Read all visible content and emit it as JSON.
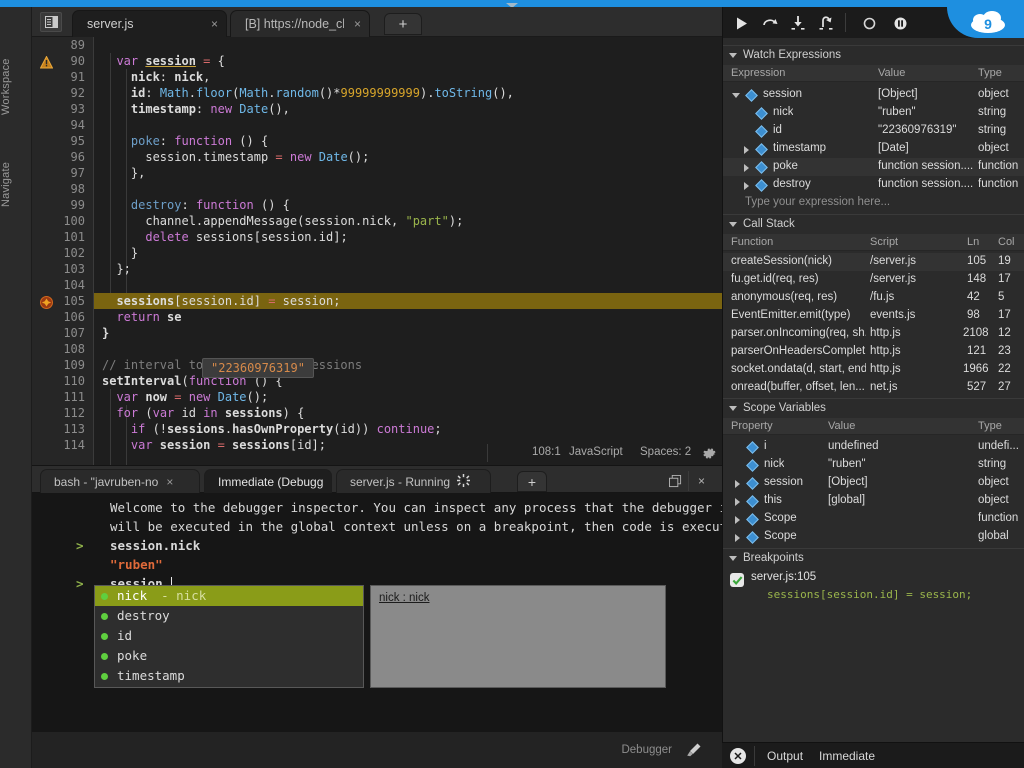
{
  "window": {
    "accent_blue": "#1e8fe0",
    "rail": {
      "workspace": "Workspace",
      "navigate": "Navigate"
    }
  },
  "editor_tabs": {
    "toggle_icon": "panel-toggle-icon",
    "tabs": [
      {
        "label": "server.js",
        "close": "×",
        "active": true
      },
      {
        "label": "[B] https://node_chat",
        "close": "×",
        "active": false
      }
    ],
    "new_tab": "+"
  },
  "editor": {
    "first_line": 89,
    "warning_line": 90,
    "breakpoint_line": 105,
    "highlight_line": 105,
    "tooltip_value": "\"22360976319\"",
    "lines": [
      {
        "n": 89,
        "text": ""
      },
      {
        "n": 90,
        "text": "  var session = {"
      },
      {
        "n": 91,
        "text": "    nick: nick,"
      },
      {
        "n": 92,
        "text": "    id: Math.floor(Math.random()*99999999999).toString(),"
      },
      {
        "n": 93,
        "text": "    timestamp: new Date(),"
      },
      {
        "n": 94,
        "text": ""
      },
      {
        "n": 95,
        "text": "    poke: function () {"
      },
      {
        "n": 96,
        "text": "      session.timestamp = new Date();"
      },
      {
        "n": 97,
        "text": "    },"
      },
      {
        "n": 98,
        "text": ""
      },
      {
        "n": 99,
        "text": "    destroy: function () {"
      },
      {
        "n": 100,
        "text": "      channel.appendMessage(session.nick, \"part\");"
      },
      {
        "n": 101,
        "text": "      delete sessions[session.id];"
      },
      {
        "n": 102,
        "text": "    }"
      },
      {
        "n": 103,
        "text": "  };"
      },
      {
        "n": 104,
        "text": ""
      },
      {
        "n": 105,
        "text": "  sessions[session.id] = session;"
      },
      {
        "n": 106,
        "text": "  return se"
      },
      {
        "n": 107,
        "text": "}"
      },
      {
        "n": 108,
        "text": ""
      },
      {
        "n": 109,
        "text": "// interval to kill off old sessions"
      },
      {
        "n": 110,
        "text": "setInterval(function () {"
      },
      {
        "n": 111,
        "text": "  var now = new Date();"
      },
      {
        "n": 112,
        "text": "  for (var id in sessions) {"
      },
      {
        "n": 113,
        "text": "    if (!sessions.hasOwnProperty(id)) continue;"
      },
      {
        "n": 114,
        "text": "    var session = sessions[id];"
      }
    ]
  },
  "editor_status": {
    "position": "108:1",
    "language": "JavaScript",
    "spaces": "Spaces: 2",
    "settings_icon": "gear-icon"
  },
  "console_tabs": {
    "tabs": [
      {
        "label": "bash - \"javruben-no",
        "close": "×",
        "active": false
      },
      {
        "label": "Immediate (Debugg",
        "close": "×",
        "active": true
      },
      {
        "label": "server.js - Running",
        "close": "",
        "active": false,
        "spinner": true
      }
    ],
    "new_tab": "+",
    "maximize_icon": "restore-icon",
    "close_icon": "×"
  },
  "console": {
    "welcome_line1": "Welcome to the debugger inspector. You can inspect any process that the debugger is attached to",
    "welcome_line2": "will be executed in the global context unless on a breakpoint, then code is executed in the cur",
    "entries": [
      {
        "prompt": ">",
        "input": "session.nick"
      },
      {
        "prompt": "",
        "output": "\"ruben\""
      },
      {
        "prompt": ">",
        "input": "session."
      }
    ]
  },
  "autocomplete": {
    "items": [
      {
        "label": "nick",
        "hint": "- nick",
        "selected": true
      },
      {
        "label": "destroy",
        "hint": "",
        "selected": false
      },
      {
        "label": "id",
        "hint": "",
        "selected": false
      },
      {
        "label": "poke",
        "hint": "",
        "selected": false
      },
      {
        "label": "timestamp",
        "hint": "",
        "selected": false
      }
    ],
    "doc_title": "nick : nick"
  },
  "bottom_bar": {
    "debugger_label": "Debugger",
    "brush_icon": "brush-icon"
  },
  "debug_toolbar": {
    "buttons": [
      {
        "icon": "resume-icon"
      },
      {
        "icon": "step-over-icon"
      },
      {
        "icon": "step-into-icon"
      },
      {
        "icon": "step-out-icon"
      },
      {
        "icon": "record-icon"
      },
      {
        "icon": "pause-icon"
      }
    ],
    "logo": "cloud9-logo"
  },
  "watch": {
    "title": "Watch Expressions",
    "columns": [
      "Expression",
      "Value",
      "Type"
    ],
    "rows": [
      {
        "expr": "session",
        "value": "[Object]",
        "type": "object",
        "depth": 0,
        "toggle": "down",
        "highlight": false
      },
      {
        "expr": "nick",
        "value": "\"ruben\"",
        "type": "string",
        "depth": 1,
        "toggle": "",
        "highlight": false
      },
      {
        "expr": "id",
        "value": "\"22360976319\"",
        "type": "string",
        "depth": 1,
        "toggle": "",
        "highlight": false
      },
      {
        "expr": "timestamp",
        "value": "[Date]",
        "type": "object",
        "depth": 1,
        "toggle": "right",
        "highlight": false
      },
      {
        "expr": "poke",
        "value": "function session....",
        "type": "function",
        "depth": 1,
        "toggle": "right",
        "highlight": true
      },
      {
        "expr": "destroy",
        "value": "function session....",
        "type": "function",
        "depth": 1,
        "toggle": "right",
        "highlight": false
      }
    ],
    "placeholder": "Type your expression here..."
  },
  "callstack": {
    "title": "Call Stack",
    "columns": [
      "Function",
      "Script",
      "Ln",
      "Col"
    ],
    "rows": [
      {
        "fn": "createSession(nick)",
        "script": "/server.js",
        "ln": "105",
        "col": "19",
        "active": true
      },
      {
        "fn": "fu.get.id(req, res)",
        "script": "/server.js",
        "ln": "148",
        "col": "17",
        "active": false
      },
      {
        "fn": "anonymous(req, res)",
        "script": "/fu.js",
        "ln": "42",
        "col": "5",
        "active": false
      },
      {
        "fn": "EventEmitter.emit(type)",
        "script": "events.js",
        "ln": "98",
        "col": "17",
        "active": false
      },
      {
        "fn": "parser.onIncoming(req, sh...",
        "script": "http.js",
        "ln": "2108",
        "col": "12",
        "active": false
      },
      {
        "fn": "parserOnHeadersComplet...",
        "script": "http.js",
        "ln": "121",
        "col": "23",
        "active": false
      },
      {
        "fn": "socket.ondata(d, start, end)",
        "script": "http.js",
        "ln": "1966",
        "col": "22",
        "active": false
      },
      {
        "fn": "onread(buffer, offset, len...",
        "script": "net.js",
        "ln": "527",
        "col": "27",
        "active": false
      }
    ]
  },
  "scope": {
    "title": "Scope Variables",
    "columns": [
      "Property",
      "Value",
      "Type"
    ],
    "rows": [
      {
        "prop": "i",
        "value": "undefined",
        "type": "undefi...",
        "toggle": "",
        "depth": 1
      },
      {
        "prop": "nick",
        "value": "\"ruben\"",
        "type": "string",
        "toggle": "",
        "depth": 1
      },
      {
        "prop": "session",
        "value": "[Object]",
        "type": "object",
        "toggle": "right",
        "depth": 1
      },
      {
        "prop": "this",
        "value": "[global]",
        "type": "object",
        "toggle": "right",
        "depth": 1
      },
      {
        "prop": "Scope",
        "value": "",
        "type": "function",
        "toggle": "right",
        "depth": 1
      },
      {
        "prop": "Scope",
        "value": "",
        "type": "global",
        "toggle": "right",
        "depth": 1
      }
    ]
  },
  "breakpoints": {
    "title": "Breakpoints",
    "items": [
      {
        "checked": true,
        "label": "server.js:105",
        "code": "sessions[session.id] = session;"
      }
    ]
  },
  "right_bottom": {
    "close_icon": "close-circle-icon",
    "tabs": [
      "Output",
      "Immediate"
    ]
  }
}
